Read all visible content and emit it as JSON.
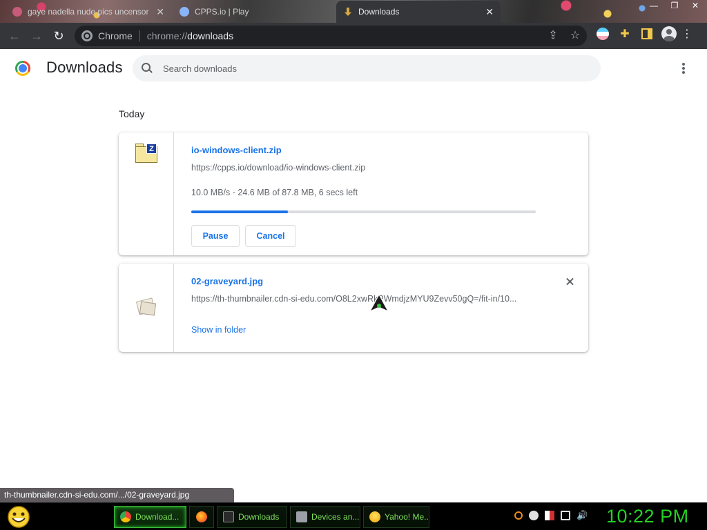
{
  "tabs": [
    {
      "title": "gaye nadella nude pics uncensor",
      "active": false
    },
    {
      "title": "CPPS.io | Play",
      "active": false
    },
    {
      "title": "Downloads",
      "active": true
    }
  ],
  "toolbar": {
    "chip_label": "Chrome",
    "url_prefix": "chrome://",
    "url_host": "downloads"
  },
  "page": {
    "title": "Downloads",
    "search_placeholder": "Search downloads"
  },
  "sections": {
    "today": "Today"
  },
  "downloads": [
    {
      "filename": "io-windows-client.zip",
      "url": "https://cpps.io/download/io-windows-client.zip",
      "status": "10.0 MB/s - 24.6 MB of 87.8 MB, 6 secs left",
      "progress": 0.28,
      "pause_label": "Pause",
      "cancel_label": "Cancel",
      "icon": "zip-archive-icon"
    },
    {
      "filename": "02-graveyard.jpg",
      "url": "https://th-thumbnailer.cdn-si-edu.com/O8L2xwRkPWmdjzMYU9Zevv50gQ=/fit-in/10...",
      "show_in_folder_label": "Show in folder",
      "icon": "image-file-icon"
    }
  ],
  "link_status": "th-thumbnailer.cdn-si-edu.com/.../02-graveyard.jpg",
  "taskbar": {
    "items": [
      {
        "label": "Download..."
      },
      {
        "label": ""
      },
      {
        "label": "Downloads"
      },
      {
        "label": "Devices an..."
      },
      {
        "label": "Yahoo! Me..."
      }
    ],
    "clock": "10:22 PM"
  },
  "colors": {
    "accent": "#1a73e8",
    "toolbar_bg": "#35363a",
    "clock": "#25d125"
  }
}
